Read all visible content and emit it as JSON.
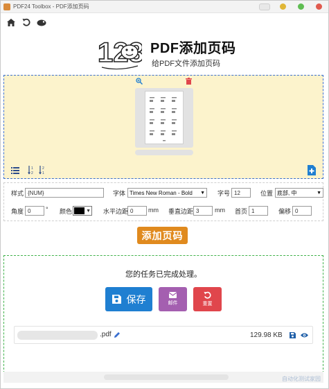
{
  "window": {
    "title": "PDF24 Toolbox - PDF添加页码"
  },
  "header": {
    "title": "PDF添加页码",
    "subtitle": "给PDF文件添加页码"
  },
  "settings": {
    "style_label": "样式",
    "style_value": "{NUM}",
    "font_label": "字体",
    "font_value": "Times New Roman - Bold",
    "size_label": "字号",
    "size_value": "12",
    "position_label": "位置",
    "position_value": "底部, 中",
    "angle_label": "角度",
    "angle_value": "0",
    "angle_unit": "°",
    "color_label": "颜色",
    "color_value": "#000000",
    "hmargin_label": "水平边距",
    "hmargin_value": "0",
    "hmargin_unit": "mm",
    "vmargin_label": "垂直边距",
    "vmargin_value": "3",
    "vmargin_unit": "mm",
    "firstpage_label": "首页",
    "firstpage_value": "1",
    "offset_label": "偏移",
    "offset_value": "0"
  },
  "actions": {
    "add_label": "添加页码"
  },
  "result": {
    "done_text": "您的任务已完成处理。",
    "save_label": "保存",
    "mail_label": "邮件",
    "reset_label": "重置",
    "file_ext": ".pdf",
    "file_size": "129.98 KB"
  },
  "colors": {
    "accent_orange": "#e08a1e",
    "save_blue": "#1f7fd1",
    "mail_purple": "#a45fb0",
    "reset_red": "#e0464c",
    "preview_bg": "#fcf3cc",
    "preview_border": "#3a6fd0",
    "result_border": "#3fb24a"
  },
  "watermark": "自动化测试家园"
}
